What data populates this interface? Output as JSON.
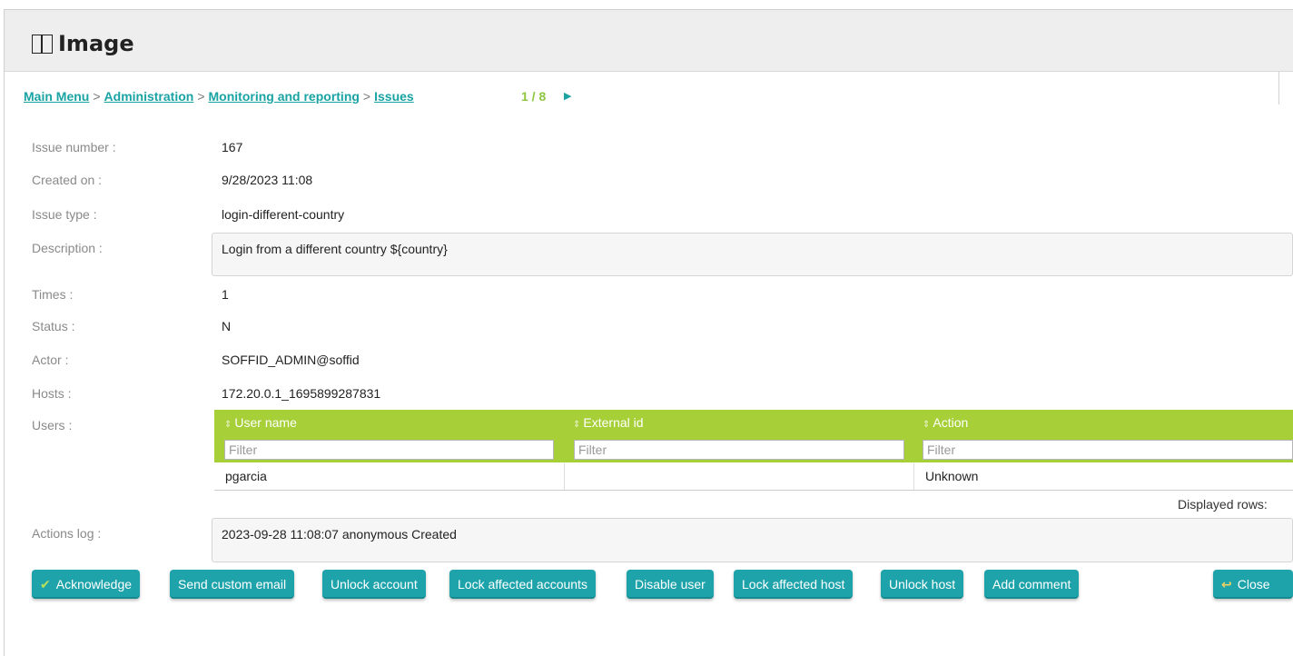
{
  "window": {
    "title": "Image"
  },
  "breadcrumb": {
    "items": [
      "Main Menu",
      "Administration",
      "Monitoring and reporting",
      "Issues"
    ],
    "separator": ">"
  },
  "pager": {
    "text": "1 / 8",
    "next_icon": "play-right-icon"
  },
  "fields": {
    "issue_number": {
      "label": "Issue number :",
      "value": "167"
    },
    "created_on": {
      "label": "Created on :",
      "value": "9/28/2023 11:08"
    },
    "issue_type": {
      "label": "Issue type :",
      "value": "login-different-country"
    },
    "description": {
      "label": "Description :",
      "value": "Login from a different country ${country}"
    },
    "times": {
      "label": "Times :",
      "value": "1"
    },
    "status": {
      "label": "Status :",
      "value": "N"
    },
    "actor": {
      "label": "Actor :",
      "value": "SOFFID_ADMIN@soffid"
    },
    "hosts": {
      "label": "Hosts :",
      "value": "172.20.0.1_1695899287831"
    },
    "users": {
      "label": "Users :"
    },
    "actions_log": {
      "label": "Actions log :",
      "value": "2023-09-28 11:08:07 anonymous Created"
    }
  },
  "users_grid": {
    "columns": [
      "User name",
      "External id",
      "Action"
    ],
    "filter_placeholder": "Filter",
    "rows": [
      [
        "pgarcia",
        "",
        "Unknown"
      ]
    ],
    "footer": "Displayed rows:"
  },
  "buttons": {
    "acknowledge": "Acknowledge",
    "send_custom_email": "Send custom email",
    "unlock_account": "Unlock account",
    "lock_affected_accounts": "Lock affected accounts",
    "disable_user": "Disable user",
    "lock_affected_host": "Lock affected host",
    "unlock_host": "Unlock host",
    "add_comment": "Add comment",
    "close": "Close"
  },
  "colors": {
    "accent": "#1fa3ab",
    "link": "#1aa3a3",
    "grid_header": "#a6cf38",
    "pager": "#8dc63f"
  }
}
